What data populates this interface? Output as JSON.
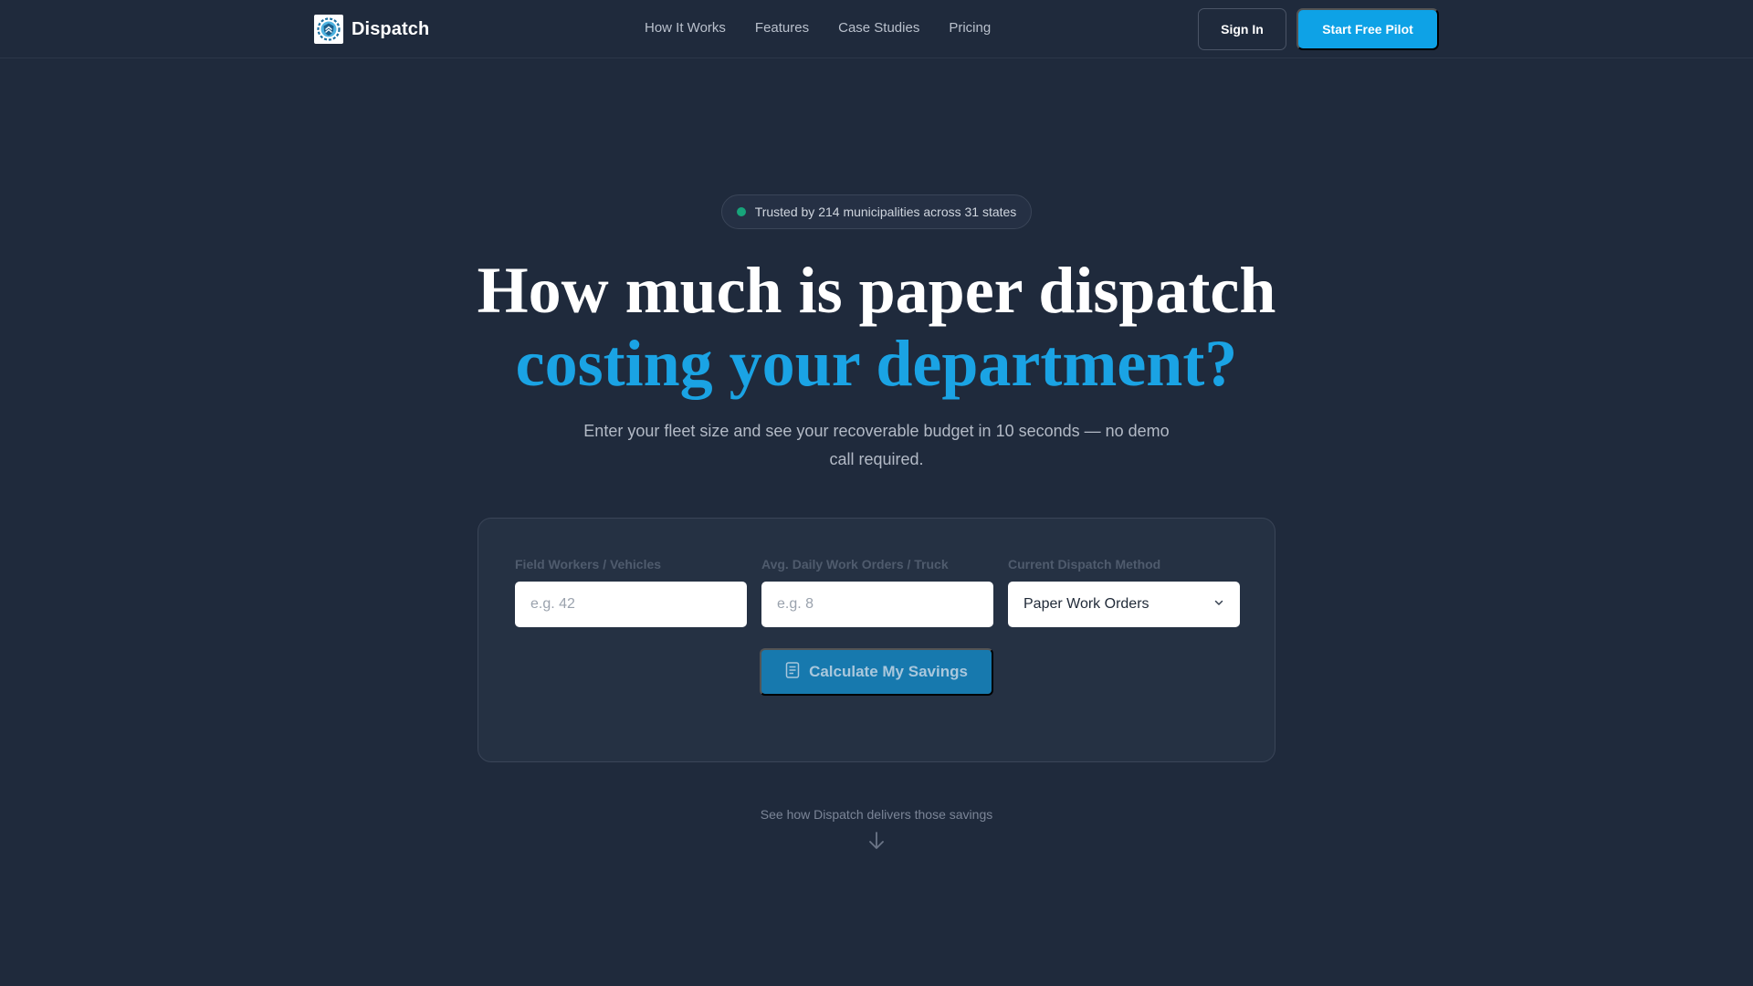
{
  "nav": {
    "brand": "Dispatch",
    "links": [
      "How It Works",
      "Features",
      "Case Studies",
      "Pricing"
    ],
    "sign_in": "Sign In",
    "cta": "Start Free Pilot"
  },
  "hero": {
    "badge": "Trusted by 214 municipalities across 31 states",
    "headline_line1": "How much is paper dispatch",
    "headline_line2": "costing your department?",
    "subtitle": "Enter your fleet size and see your recoverable budget in 10 seconds — no demo call required."
  },
  "calculator": {
    "fields": [
      {
        "label": "Field Workers / Vehicles",
        "placeholder": "e.g. 42",
        "value": ""
      },
      {
        "label": "Avg. Daily Work Orders / Truck",
        "placeholder": "e.g. 8",
        "value": ""
      }
    ],
    "method": {
      "label": "Current Dispatch Method",
      "selected": "Paper Work Orders"
    },
    "button": "Calculate My Savings"
  },
  "scroll_hint": "See how Dispatch delivers those savings",
  "colors": {
    "background": "#1f2a3c",
    "accent": "#0ea2e6",
    "headline_accent": "#1aa3e4",
    "badge_dot": "#17a47a",
    "card": "#253143"
  },
  "icons": {
    "logo": "gear-shield-logo-icon",
    "calculator": "document-icon",
    "select": "chevron-down-icon",
    "scroll": "arrow-down-icon"
  }
}
